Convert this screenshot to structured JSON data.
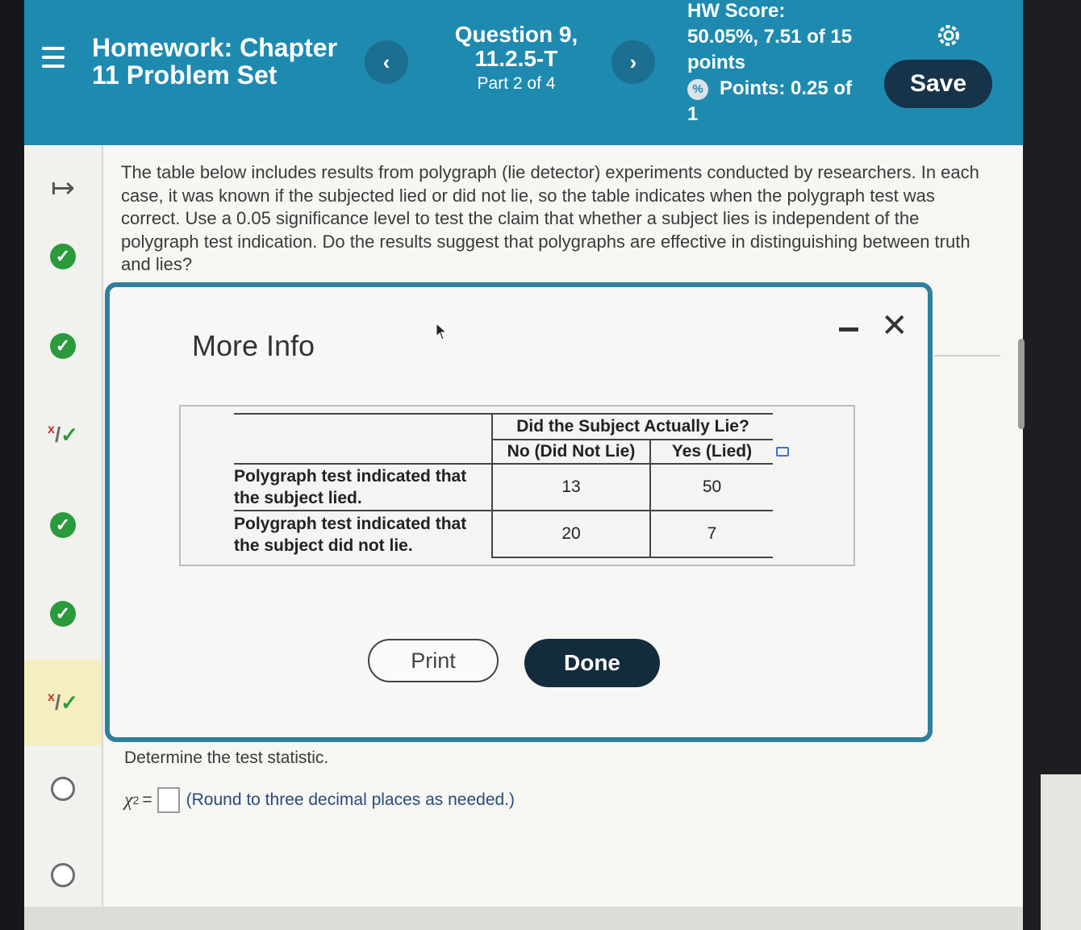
{
  "header": {
    "title": "Homework: Chapter 11 Problem Set",
    "question_title": "Question 9, 11.2.5-T",
    "part": "Part 2 of 4",
    "hw_score_label": "HW Score:",
    "hw_score_value": "50.05%, 7.51 of 15 points",
    "points_label": "Points: 0.25 of 1",
    "save_label": "Save",
    "prev_icon": "chevron-left",
    "next_icon": "chevron-right",
    "accent_color": "#1f8ab0"
  },
  "sidebar": {
    "items": [
      {
        "status": "arrow"
      },
      {
        "status": "correct"
      },
      {
        "status": "correct"
      },
      {
        "status": "partial"
      },
      {
        "status": "correct"
      },
      {
        "status": "correct"
      },
      {
        "status": "partial-active"
      },
      {
        "status": "unanswered"
      },
      {
        "status": "unanswered"
      }
    ]
  },
  "question": {
    "text": "The table below includes results from polygraph (lie detector) experiments conducted by researchers. In each case, it was known if the subjected lied or did not lie, so the table indicates when the polygraph test was correct. Use a 0.05 significance level to test the claim that whether a subject lies is independent of the polygraph test indication. Do the results suggest that polygraphs are effective in distinguishing between truth and lies?",
    "determine": "Determine the test statistic.",
    "chi_symbol": "χ",
    "chi_sup": "2",
    "equals": "=",
    "round_note": "(Round to three decimal places as needed.)"
  },
  "modal": {
    "title": "More Info",
    "table": {
      "group_header": "Did the Subject Actually Lie?",
      "columns": [
        "No (Did Not Lie)",
        "Yes (Lied)"
      ],
      "rows": [
        {
          "label_line1": "Polygraph test indicated that",
          "label_line2": "the subject lied.",
          "values": [
            "13",
            "50"
          ]
        },
        {
          "label_line1": "Polygraph test indicated that",
          "label_line2": "the subject did not lie.",
          "values": [
            "20",
            "7"
          ]
        }
      ]
    },
    "print_label": "Print",
    "done_label": "Done"
  }
}
